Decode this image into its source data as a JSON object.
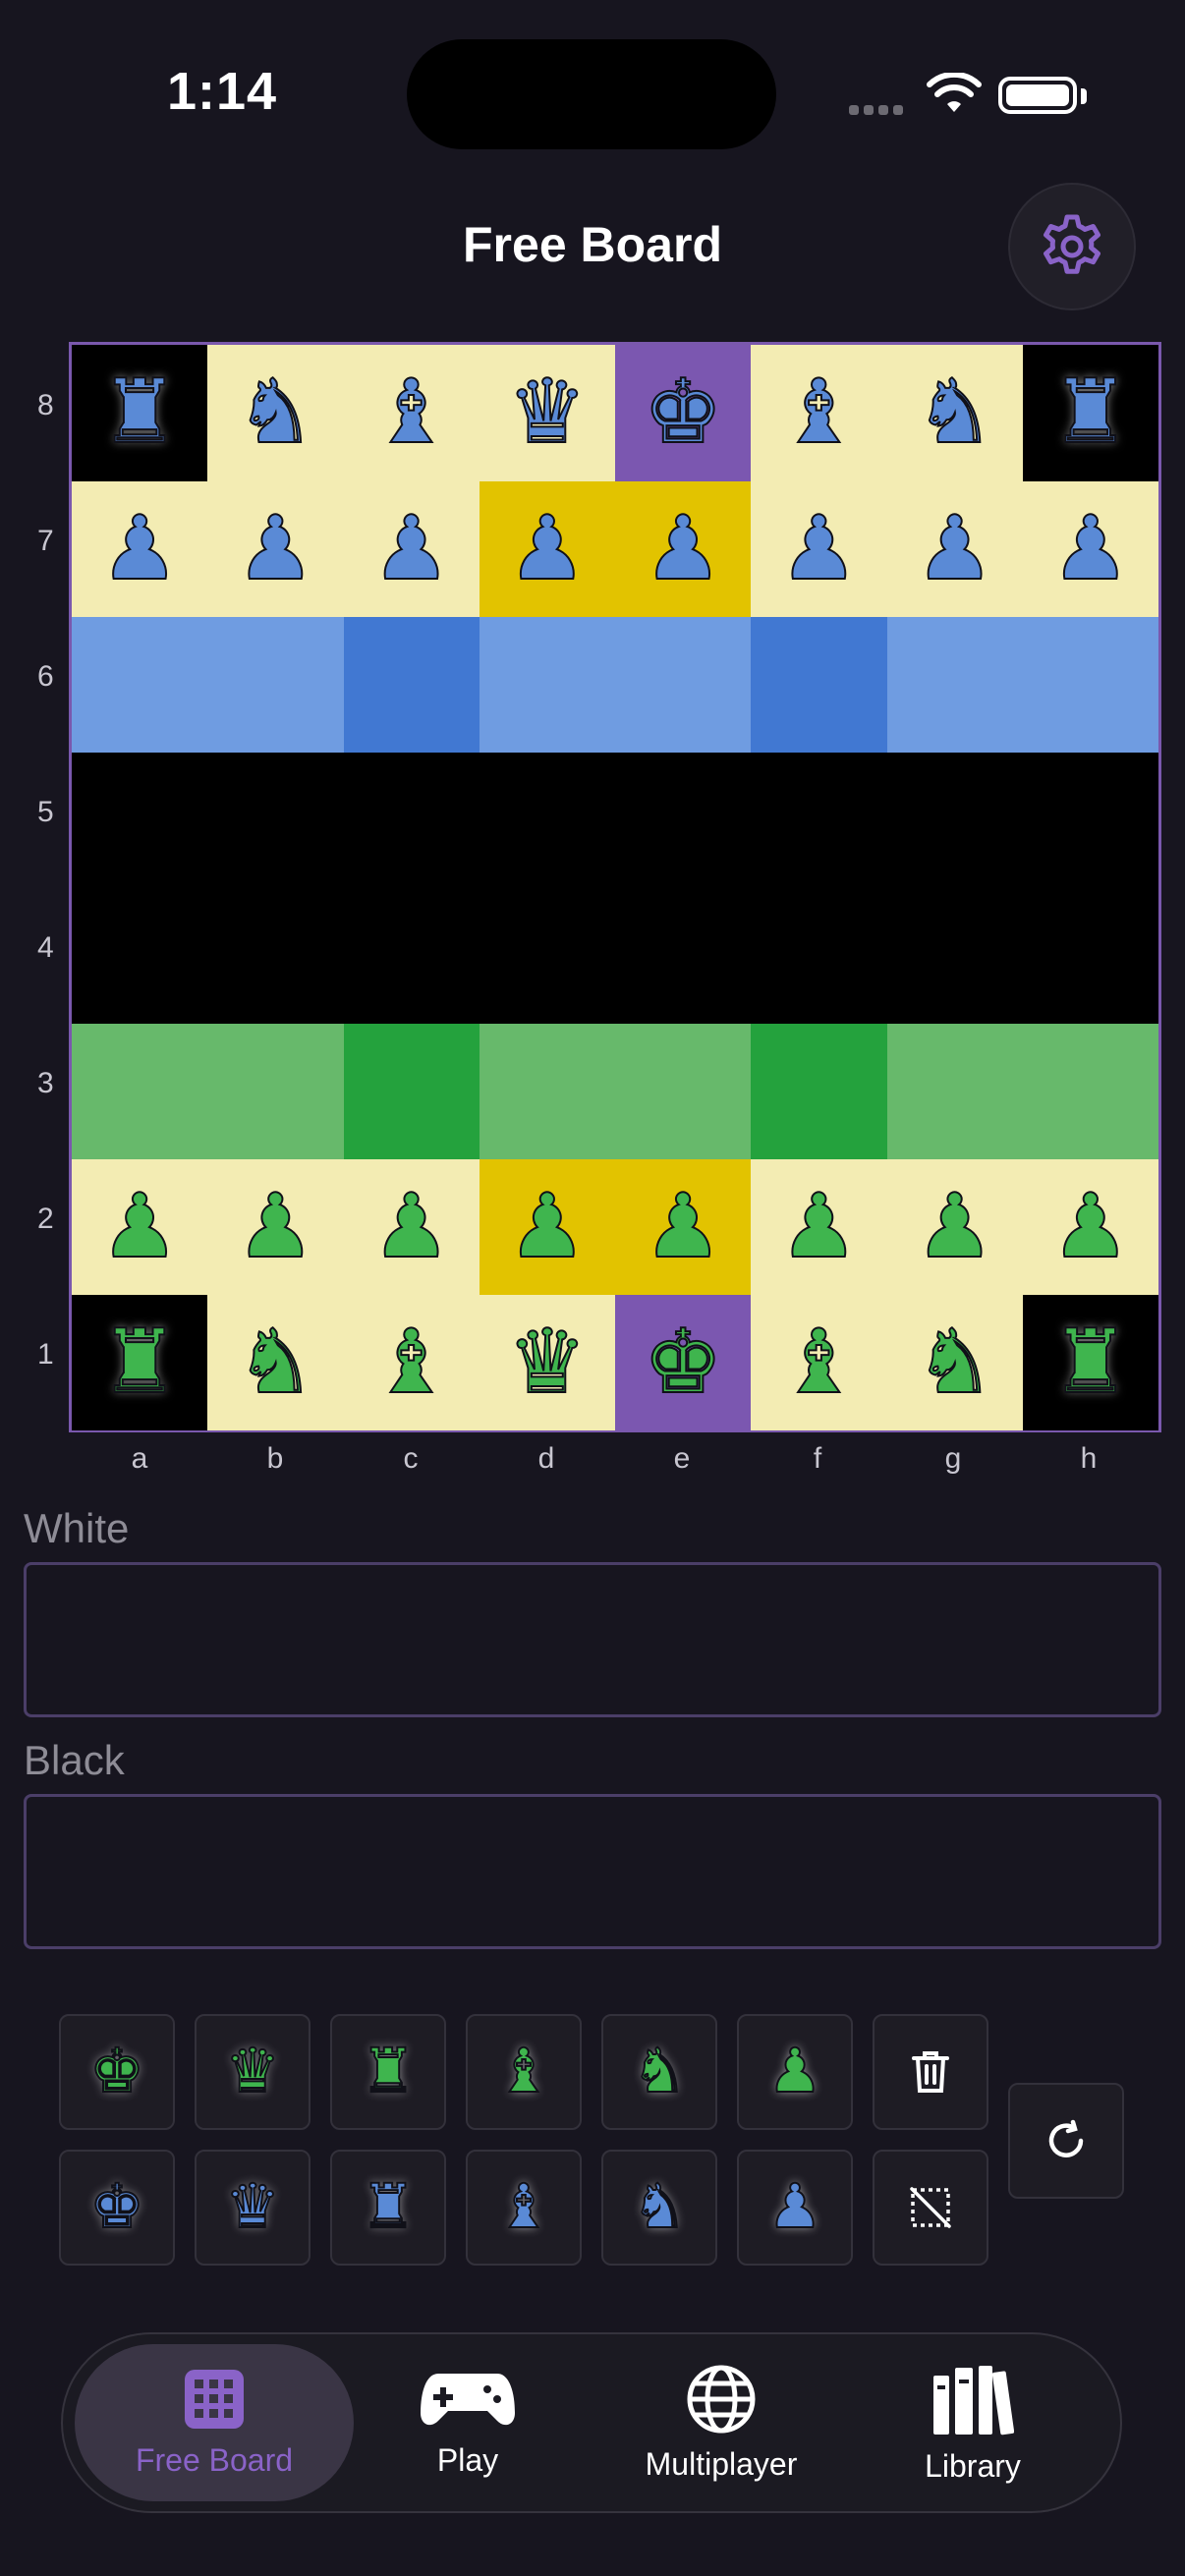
{
  "status_bar": {
    "time": "1:14"
  },
  "header": {
    "title": "Free Board"
  },
  "colors": {
    "light_square": "#f3ecb3",
    "corner_black": "#000000",
    "king_file_purple": "#7b57b0",
    "highlight_yellow": "#e2c300",
    "blue_light": "#6f9ce1",
    "blue_dark": "#4178d2",
    "green_light": "#67b96b",
    "green_dark": "#24a23d",
    "accent_purple": "#8a63c8"
  },
  "board": {
    "ranks": [
      "8",
      "7",
      "6",
      "5",
      "4",
      "3",
      "2",
      "1"
    ],
    "files": [
      "a",
      "b",
      "c",
      "d",
      "e",
      "f",
      "g",
      "h"
    ],
    "rows": [
      [
        {
          "c": "corner_black",
          "p": "♜",
          "s": "blue"
        },
        {
          "c": "light_square",
          "p": "♞",
          "s": "blue"
        },
        {
          "c": "light_square",
          "p": "♝",
          "s": "blue"
        },
        {
          "c": "light_square",
          "p": "♛",
          "s": "blue"
        },
        {
          "c": "king_file_purple",
          "p": "♚",
          "s": "blue"
        },
        {
          "c": "light_square",
          "p": "♝",
          "s": "blue"
        },
        {
          "c": "light_square",
          "p": "♞",
          "s": "blue"
        },
        {
          "c": "corner_black",
          "p": "♜",
          "s": "blue"
        }
      ],
      [
        {
          "c": "light_square",
          "p": "♟",
          "s": "blue"
        },
        {
          "c": "light_square",
          "p": "♟",
          "s": "blue"
        },
        {
          "c": "light_square",
          "p": "♟",
          "s": "blue"
        },
        {
          "c": "highlight_yellow",
          "p": "♟",
          "s": "blue"
        },
        {
          "c": "highlight_yellow",
          "p": "♟",
          "s": "blue"
        },
        {
          "c": "light_square",
          "p": "♟",
          "s": "blue"
        },
        {
          "c": "light_square",
          "p": "♟",
          "s": "blue"
        },
        {
          "c": "light_square",
          "p": "♟",
          "s": "blue"
        }
      ],
      [
        {
          "c": "blue_light"
        },
        {
          "c": "blue_light"
        },
        {
          "c": "blue_dark"
        },
        {
          "c": "blue_light"
        },
        {
          "c": "blue_light"
        },
        {
          "c": "blue_dark"
        },
        {
          "c": "blue_light"
        },
        {
          "c": "blue_light"
        }
      ],
      [
        {
          "c": "corner_black"
        },
        {
          "c": "corner_black"
        },
        {
          "c": "corner_black"
        },
        {
          "c": "corner_black"
        },
        {
          "c": "corner_black"
        },
        {
          "c": "corner_black"
        },
        {
          "c": "corner_black"
        },
        {
          "c": "corner_black"
        }
      ],
      [
        {
          "c": "corner_black"
        },
        {
          "c": "corner_black"
        },
        {
          "c": "corner_black"
        },
        {
          "c": "corner_black"
        },
        {
          "c": "corner_black"
        },
        {
          "c": "corner_black"
        },
        {
          "c": "corner_black"
        },
        {
          "c": "corner_black"
        }
      ],
      [
        {
          "c": "green_light"
        },
        {
          "c": "green_light"
        },
        {
          "c": "green_dark"
        },
        {
          "c": "green_light"
        },
        {
          "c": "green_light"
        },
        {
          "c": "green_dark"
        },
        {
          "c": "green_light"
        },
        {
          "c": "green_light"
        }
      ],
      [
        {
          "c": "light_square",
          "p": "♟",
          "s": "green"
        },
        {
          "c": "light_square",
          "p": "♟",
          "s": "green"
        },
        {
          "c": "light_square",
          "p": "♟",
          "s": "green"
        },
        {
          "c": "highlight_yellow",
          "p": "♟",
          "s": "green"
        },
        {
          "c": "highlight_yellow",
          "p": "♟",
          "s": "green"
        },
        {
          "c": "light_square",
          "p": "♟",
          "s": "green"
        },
        {
          "c": "light_square",
          "p": "♟",
          "s": "green"
        },
        {
          "c": "light_square",
          "p": "♟",
          "s": "green"
        }
      ],
      [
        {
          "c": "corner_black",
          "p": "♜",
          "s": "green"
        },
        {
          "c": "light_square",
          "p": "♞",
          "s": "green"
        },
        {
          "c": "light_square",
          "p": "♝",
          "s": "green"
        },
        {
          "c": "light_square",
          "p": "♛",
          "s": "green"
        },
        {
          "c": "king_file_purple",
          "p": "♚",
          "s": "green"
        },
        {
          "c": "light_square",
          "p": "♝",
          "s": "green"
        },
        {
          "c": "light_square",
          "p": "♞",
          "s": "green"
        },
        {
          "c": "corner_black",
          "p": "♜",
          "s": "green"
        }
      ]
    ]
  },
  "players": {
    "white_label": "White",
    "white_value": "",
    "black_label": "Black",
    "black_value": ""
  },
  "piece_tray": {
    "green_row": [
      {
        "glyph": "♚",
        "icon": "green-king-icon"
      },
      {
        "glyph": "♛",
        "icon": "green-queen-icon"
      },
      {
        "glyph": "♜",
        "icon": "green-rook-icon"
      },
      {
        "glyph": "♝",
        "icon": "green-bishop-icon"
      },
      {
        "glyph": "♞",
        "icon": "green-knight-icon"
      },
      {
        "glyph": "♟",
        "icon": "green-pawn-icon"
      }
    ],
    "blue_row": [
      {
        "glyph": "♚",
        "icon": "blue-king-icon"
      },
      {
        "glyph": "♛",
        "icon": "blue-queen-icon"
      },
      {
        "glyph": "♜",
        "icon": "blue-rook-icon"
      },
      {
        "glyph": "♝",
        "icon": "blue-bishop-icon"
      },
      {
        "glyph": "♞",
        "icon": "blue-knight-icon"
      },
      {
        "glyph": "♟",
        "icon": "blue-pawn-icon"
      }
    ],
    "tools": [
      "trash-icon",
      "clear-board-icon",
      "reset-icon"
    ]
  },
  "tab_bar": {
    "tabs": [
      {
        "label": "Free Board",
        "icon": "grid-icon",
        "active": true
      },
      {
        "label": "Play",
        "icon": "gamepad-icon",
        "active": false
      },
      {
        "label": "Multiplayer",
        "icon": "globe-icon",
        "active": false
      },
      {
        "label": "Library",
        "icon": "books-icon",
        "active": false
      }
    ]
  }
}
